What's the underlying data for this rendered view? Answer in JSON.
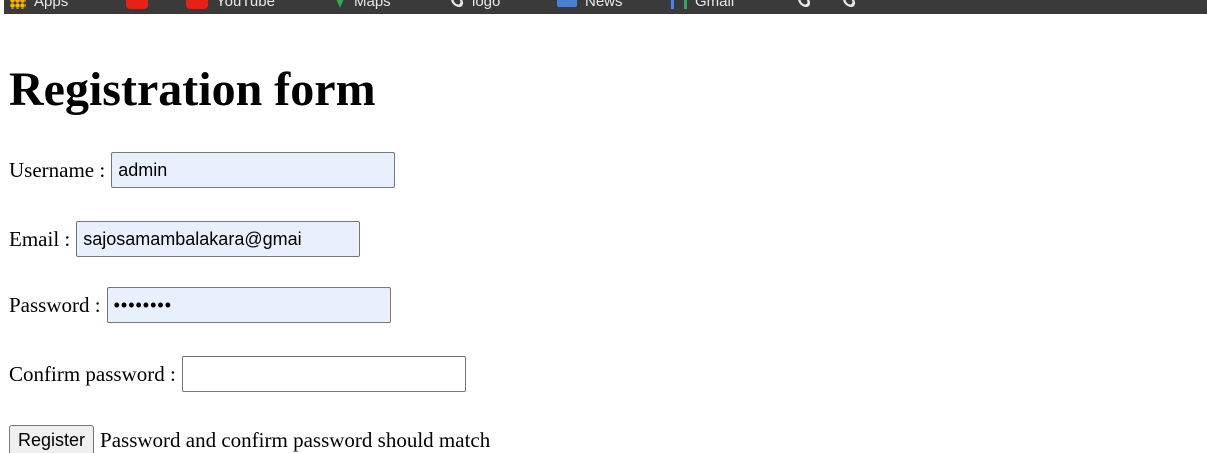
{
  "bookmarks": {
    "items": [
      {
        "label": "Apps",
        "icon": "apps-grid-icon"
      },
      {
        "label": "",
        "icon": "youtube-icon"
      },
      {
        "label": "YouTube",
        "icon": "youtube-icon"
      },
      {
        "label": "Maps",
        "icon": "maps-pin-icon"
      },
      {
        "label": "logo",
        "icon": "link-icon"
      },
      {
        "label": "News",
        "icon": "news-icon"
      },
      {
        "label": "Gmail",
        "icon": "gmail-icon"
      },
      {
        "label": "",
        "icon": "link-icon"
      },
      {
        "label": "",
        "icon": "link-icon"
      }
    ]
  },
  "form": {
    "title": "Registration form",
    "username": {
      "label": "Username :",
      "value": "admin"
    },
    "email": {
      "label": "Email :",
      "value": "sajosamambalakara@gmai"
    },
    "password": {
      "label": "Password :",
      "value": "••••••••"
    },
    "confirm_password": {
      "label": "Confirm password :",
      "value": ""
    },
    "register_label": "Register",
    "message": "Password and confirm password should match"
  },
  "colors": {
    "autofill_background": "#e8f0fe",
    "bookmarks_bar": "#3a3a3a"
  }
}
